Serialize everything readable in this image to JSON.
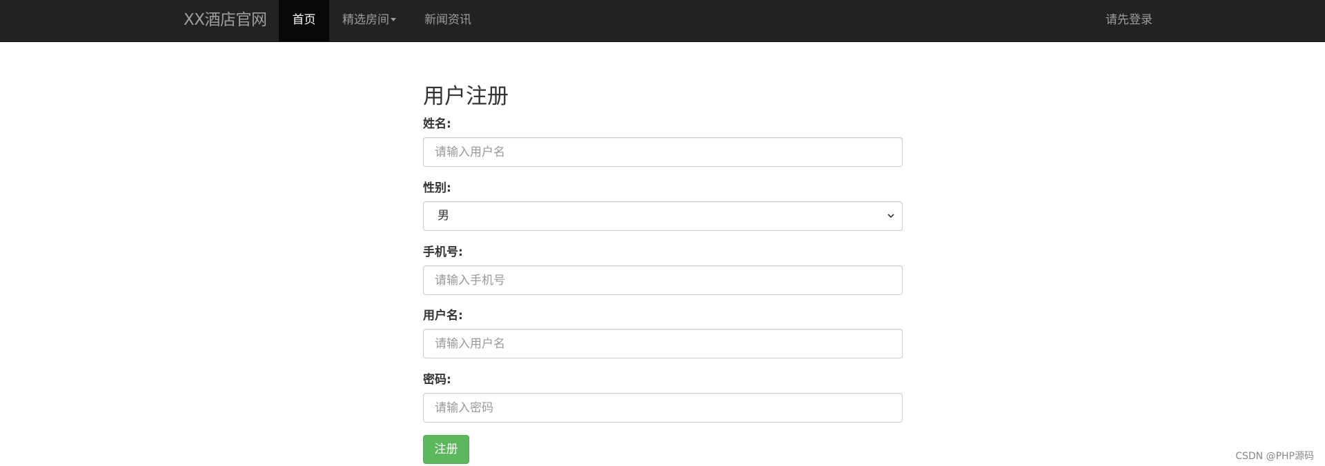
{
  "navbar": {
    "brand": "XX酒店官网",
    "items": [
      {
        "label": "首页",
        "active": true
      },
      {
        "label": "精选房间",
        "dropdown": true
      },
      {
        "label": "新闻资讯"
      }
    ],
    "login_label": "请先登录",
    "background_color": "#222222"
  },
  "form": {
    "title": "用户注册",
    "name": {
      "label": "姓名:",
      "placeholder": "请输入用户名"
    },
    "gender": {
      "label": "性别:",
      "selected": "男"
    },
    "phone": {
      "label": "手机号:",
      "placeholder": "请输入手机号"
    },
    "username": {
      "label": "用户名:",
      "placeholder": "请输入用户名"
    },
    "password": {
      "label": "密码:",
      "placeholder": "请输入密码"
    },
    "submit_label": "注册",
    "submit_color": "#5cb85c"
  },
  "watermark": "CSDN @PHP源码"
}
